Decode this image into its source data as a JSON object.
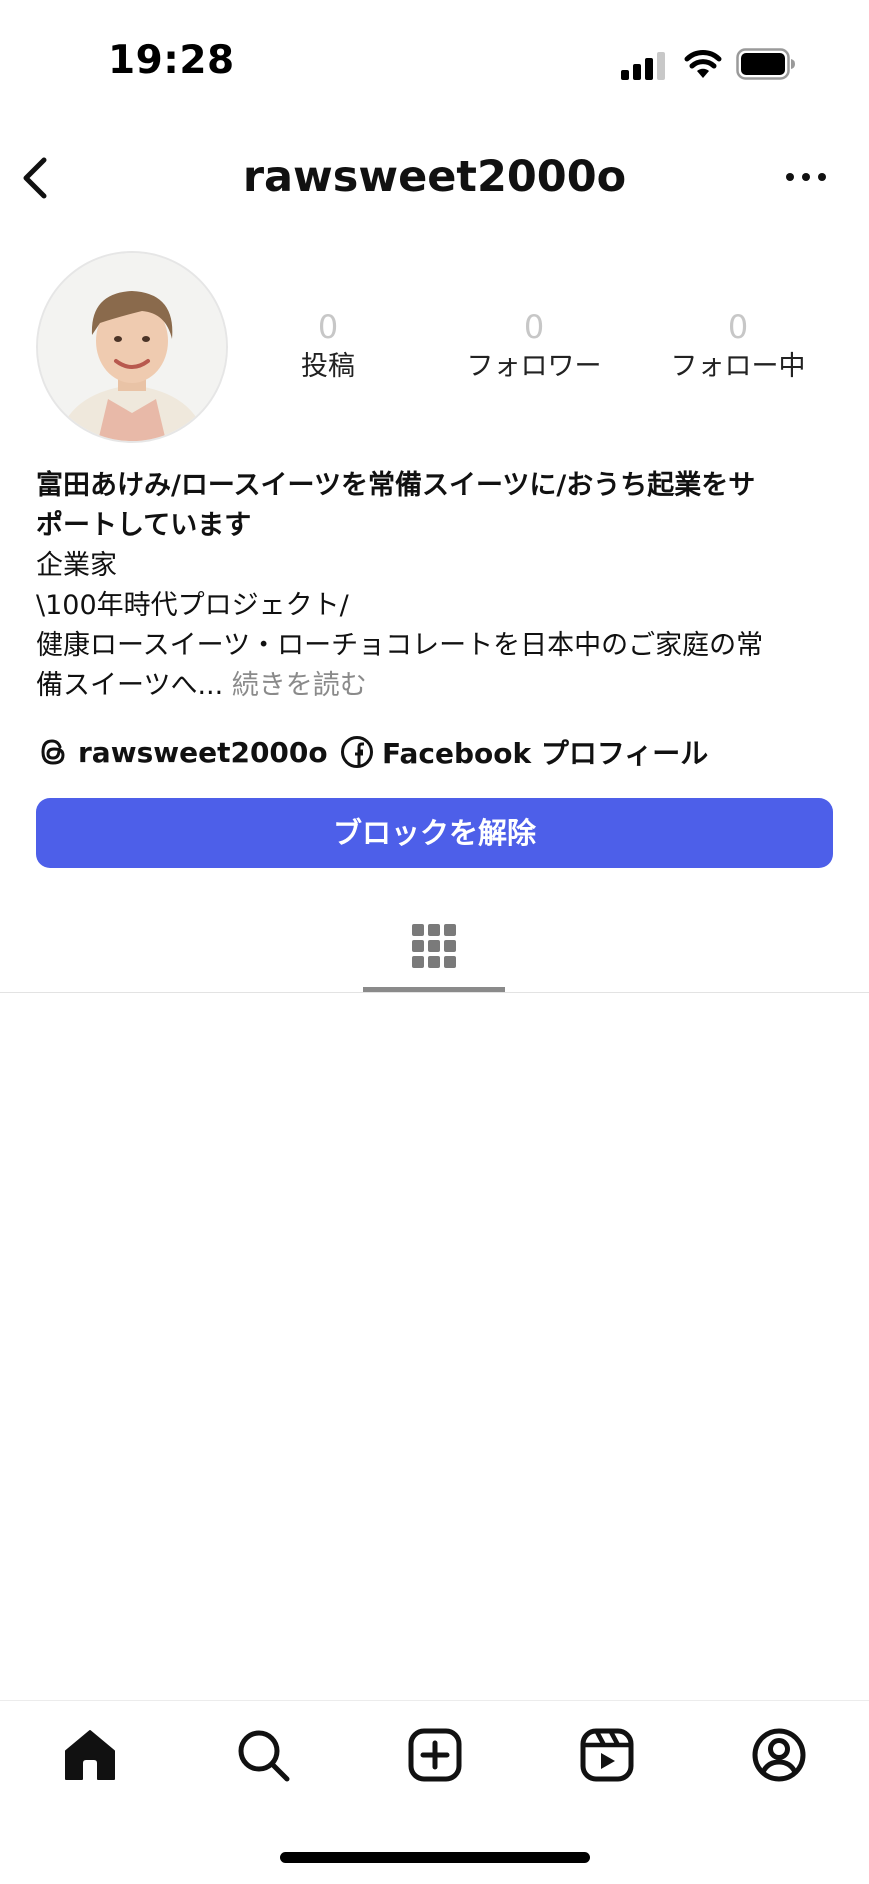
{
  "status_bar": {
    "time": "19:28"
  },
  "header": {
    "username": "rawsweet2000o"
  },
  "stats": [
    {
      "value": "0",
      "label": "投稿"
    },
    {
      "value": "0",
      "label": "フォロワー"
    },
    {
      "value": "0",
      "label": "フォロー中"
    }
  ],
  "bio": {
    "name_line1": "富田あけみ/ロースイーツを常備スイーツに/おうち起業をサ",
    "name_line2": "ポートしています",
    "line1": "企業家",
    "line2": "\\100年時代プロジェクト/",
    "line3": "健康ロースイーツ・ローチョコレートを日本中のご家庭の常",
    "line4": "備スイーツへ...",
    "more_label": " 続きを読む"
  },
  "links": {
    "threads_label": "rawsweet2000o",
    "facebook_label": "Facebook プロフィール"
  },
  "actions": {
    "unblock_label": "ブロックを解除"
  },
  "colors": {
    "accent": "#4d5fe9",
    "muted": "#8a8a8a"
  },
  "icons": {
    "back": "chevron-left-icon",
    "more": "more-horizontal-icon",
    "threads": "threads-icon",
    "facebook": "facebook-icon",
    "grid": "grid-icon",
    "home": "home-icon",
    "search": "search-icon",
    "create": "plus-square-icon",
    "reels": "reels-icon",
    "profile": "profile-icon"
  }
}
